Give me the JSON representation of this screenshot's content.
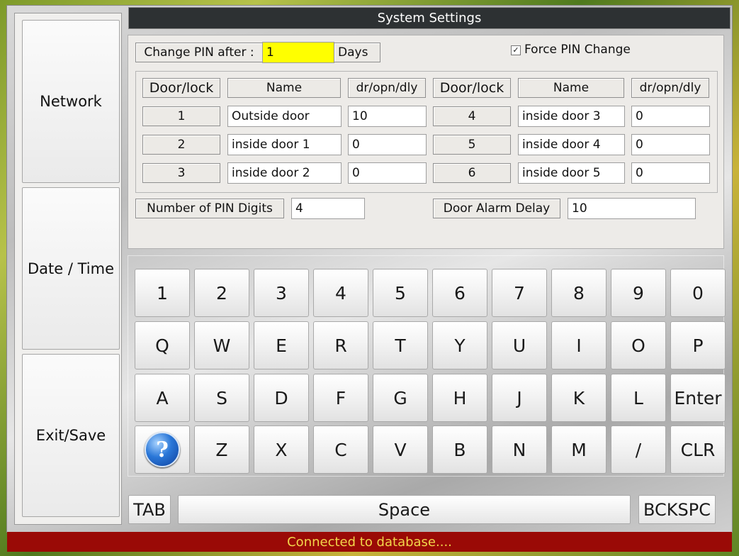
{
  "window": {
    "title": "System Settings"
  },
  "sidebar": {
    "network_label": "Network",
    "datetime_label": "Date / Time",
    "exit_label": "Exit/Save"
  },
  "settings": {
    "change_pin_label": "Change PIN after :",
    "change_pin_value": "1",
    "days_label": "Days",
    "force_pin_change_label": "Force PIN Change",
    "force_pin_change_checked": true,
    "columns": [
      "Door/lock",
      "Name",
      "dr/opn/dly",
      "Door/lock",
      "Name",
      "dr/opn/dly"
    ],
    "doors_left": [
      {
        "id": "1",
        "name": "Outside door",
        "delay": "10"
      },
      {
        "id": "2",
        "name": "inside door 1",
        "delay": "0"
      },
      {
        "id": "3",
        "name": "inside door 2",
        "delay": "0"
      }
    ],
    "doors_right": [
      {
        "id": "4",
        "name": "inside door 3",
        "delay": "0"
      },
      {
        "id": "5",
        "name": "inside door 4",
        "delay": "0"
      },
      {
        "id": "6",
        "name": "inside door 5",
        "delay": "0"
      }
    ],
    "pin_digits_label": "Number of PIN Digits",
    "pin_digits_value": "4",
    "alarm_delay_label": "Door Alarm Delay",
    "alarm_delay_value": "10"
  },
  "keyboard": {
    "rows": [
      [
        "1",
        "2",
        "3",
        "4",
        "5",
        "6",
        "7",
        "8",
        "9",
        "0"
      ],
      [
        "Q",
        "W",
        "E",
        "R",
        "T",
        "Y",
        "U",
        "I",
        "O",
        "P"
      ],
      [
        "A",
        "S",
        "D",
        "F",
        "G",
        "H",
        "J",
        "K",
        "L",
        "Enter"
      ],
      [
        "?",
        "Z",
        "X",
        "C",
        "V",
        "B",
        "N",
        "M",
        "/",
        "CLR"
      ]
    ],
    "tab_label": "TAB",
    "space_label": "Space",
    "backspace_label": "BCKSPC",
    "help_icon": "help-icon"
  },
  "status": {
    "text": "Connected to database...."
  },
  "colors": {
    "pin_field_bg": "#ffff00",
    "status_bg": "#9a0a06",
    "status_text": "#f2d64a",
    "titlebar_bg": "#2d3133"
  }
}
